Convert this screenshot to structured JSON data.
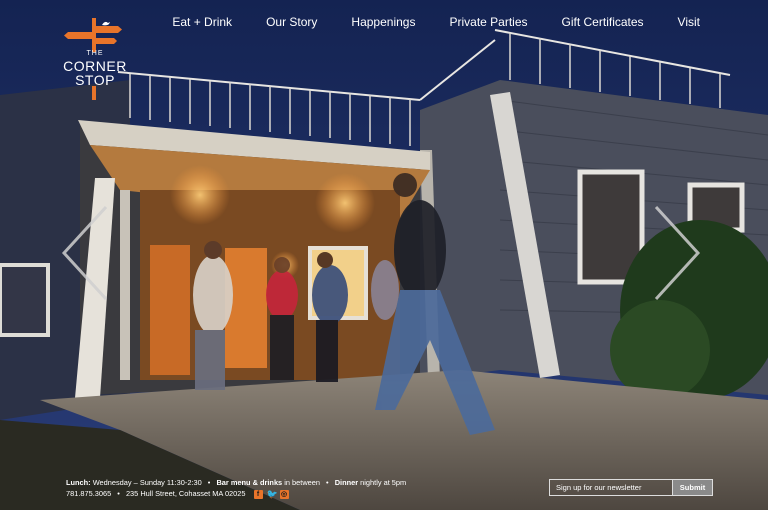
{
  "brand": {
    "the": "THE",
    "corner": "CORNER",
    "stop": "STOP",
    "accent": "#e8742a"
  },
  "nav": {
    "items": [
      {
        "label": "Eat + Drink"
      },
      {
        "label": "Our Story"
      },
      {
        "label": "Happenings"
      },
      {
        "label": "Private Parties"
      },
      {
        "label": "Gift Certificates"
      },
      {
        "label": "Visit"
      }
    ]
  },
  "slider": {
    "prev_icon": "chevron-left-icon",
    "next_icon": "chevron-right-icon"
  },
  "footer": {
    "lunch_label": "Lunch:",
    "lunch_text": "Wednesday – Sunday 11:30-2:30",
    "bar_label": "Bar menu & drinks",
    "bar_text": "in between",
    "dinner_label": "Dinner",
    "dinner_text": "nightly at 5pm",
    "phone": "781.875.3065",
    "address": "235 Hull Street, Cohasset MA 02025",
    "social": [
      "facebook-icon",
      "twitter-icon",
      "instagram-icon"
    ]
  },
  "newsletter": {
    "placeholder": "Sign up for our newsletter",
    "submit_label": "Submit"
  }
}
